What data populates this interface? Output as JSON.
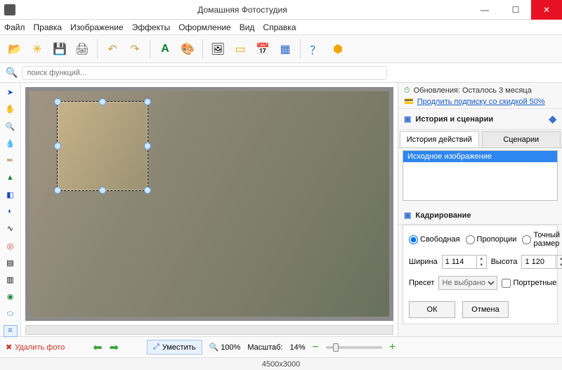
{
  "window": {
    "title": "Домашняя Фотостудия"
  },
  "menu": [
    "Файл",
    "Правка",
    "Изображение",
    "Эффекты",
    "Оформление",
    "Вид",
    "Справка"
  ],
  "toolbar": {
    "icons": [
      "open",
      "film",
      "save",
      "print",
      "undo",
      "redo",
      "text",
      "palette",
      "image",
      "frame",
      "calendar",
      "grid",
      "help",
      "home"
    ]
  },
  "search": {
    "placeholder": "поиск функций..."
  },
  "sidebar": {
    "tools": [
      "pointer",
      "hand",
      "zoom",
      "eyedropper",
      "brush",
      "clone",
      "gradient",
      "contrast",
      "curves",
      "redeye",
      "layers",
      "channels",
      "stamp",
      "eraser",
      "crop"
    ]
  },
  "right": {
    "update_line1": "Обновления: Осталось  3 месяца",
    "update_link": "Продлить подписку со скидкой 50%",
    "history_title": "История и сценарии",
    "tabs": [
      "История действий",
      "Сценарии"
    ],
    "history_items": [
      "Исходное изображение"
    ],
    "crop_title": "Кадрирование",
    "mode_labels": [
      "Свободная",
      "Пропорции",
      "Точный размер"
    ],
    "width_label": "Ширина",
    "height_label": "Высота",
    "width_value": "1 114",
    "height_value": "1 120",
    "preset_label": "Пресет",
    "preset_value": "Не выбрано",
    "portrait_label": "Портретные",
    "ok": "ОК",
    "cancel": "Отмена"
  },
  "bottom": {
    "delete_label": "Удалить фото",
    "fit_label": "Уместить",
    "zoom_fixed": "100%",
    "scale_label": "Масштаб:",
    "scale_value": "14%"
  },
  "status": {
    "dimensions": "4500x3000"
  }
}
